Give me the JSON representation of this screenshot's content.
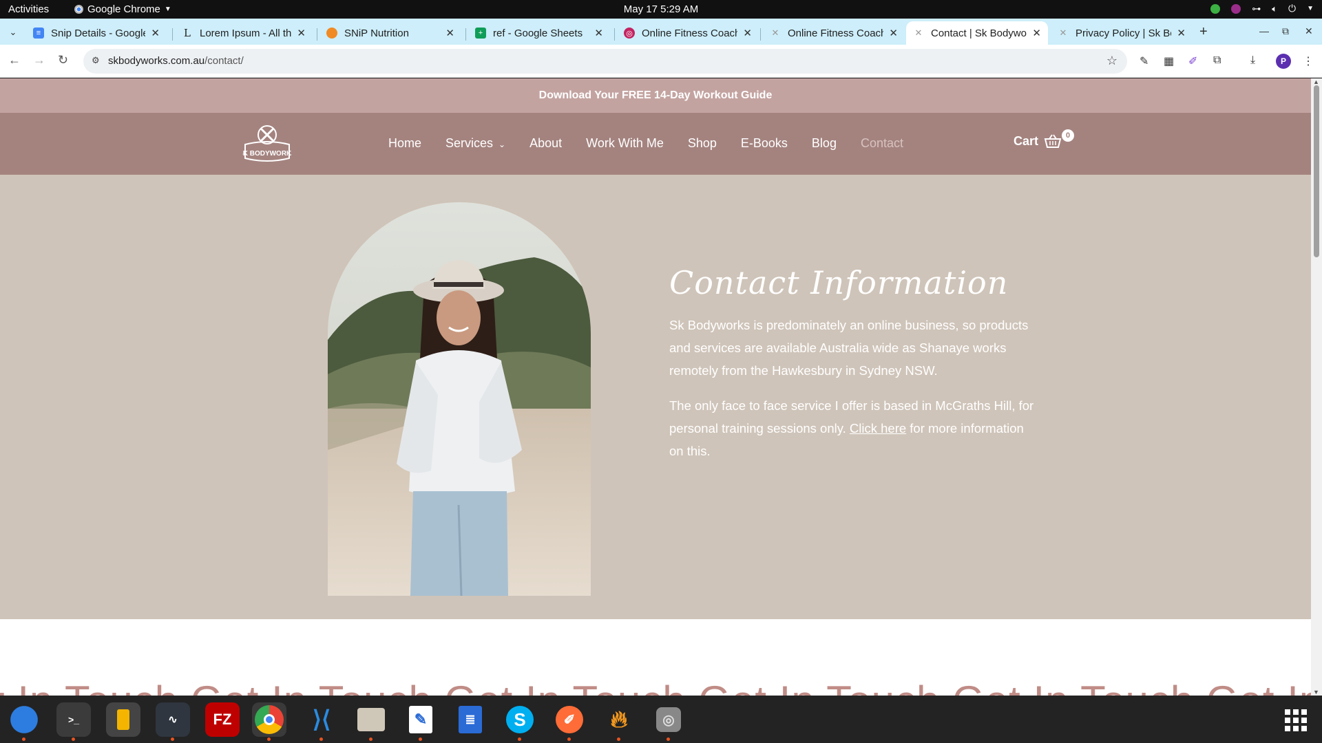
{
  "topbar": {
    "activities": "Activities",
    "app_name": "Google Chrome",
    "clock": "May 17  5:29 AM"
  },
  "tabs": [
    {
      "title": "Snip Details - Google",
      "icon": "google-docs-icon",
      "active": false
    },
    {
      "title": "Lorem Ipsum - All the",
      "icon": "lipsum-icon",
      "active": false
    },
    {
      "title": "SNiP Nutrition",
      "icon": "snip-icon",
      "active": false
    },
    {
      "title": "ref - Google Sheets",
      "icon": "google-sheets-icon",
      "active": false
    },
    {
      "title": "Online Fitness Coach",
      "icon": "dribbble-icon",
      "active": false
    },
    {
      "title": "Online Fitness Coach",
      "icon": "sk-bodyworks-icon",
      "active": false
    },
    {
      "title": "Contact | Sk Bodywo",
      "icon": "sk-bodyworks-icon",
      "active": true
    },
    {
      "title": "Privacy Policy | Sk Bo",
      "icon": "sk-bodyworks-icon",
      "active": false
    }
  ],
  "address": {
    "domain": "skbodyworks.com.au",
    "path": "/contact/"
  },
  "site": {
    "promo": "Download Your FREE 14-Day Workout Guide",
    "logo_text": "SK BODYWORKS",
    "nav": [
      "Home",
      "Services",
      "About",
      "Work With Me",
      "Shop",
      "E-Books",
      "Blog",
      "Contact"
    ],
    "cart_label": "Cart",
    "cart_count": "0",
    "contact_heading": "Contact Information",
    "para1": "Sk Bodyworks is predominately an online business, so products and services are available Australia wide as Shanaye works remotely from the Hawkesbury in Sydney NSW.",
    "para2_before": "The only face to face service I offer is based in McGraths Hill, for personal training sessions only. ",
    "para2_link": "Click here",
    "para2_after": " for more information on this.",
    "marquee": "t In Touch  Get In Touch  Get In Touch  Get In Touch  Get In Touch  Get In Touch"
  },
  "colors": {
    "promo_bg": "#c3a3a0",
    "header_bg": "#a4837f",
    "hero_bg": "#cfc4b9",
    "marquee": "#c08c86"
  },
  "dock": [
    "thunderbird-icon",
    "terminal-icon",
    "text-editor-icon",
    "system-monitor-icon",
    "filezilla-icon",
    "chrome-icon",
    "vscode-icon",
    "files-icon",
    "gedit-icon",
    "writer-icon",
    "skype-icon",
    "postman-icon",
    "brave-icon",
    "disk-icon"
  ]
}
